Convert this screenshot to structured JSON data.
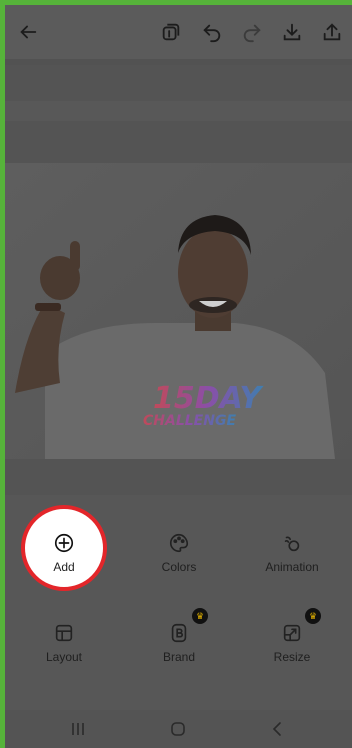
{
  "toolbar": {
    "back_icon": "arrow-left-icon",
    "pages_icon": "pages-icon",
    "undo_icon": "undo-icon",
    "redo_icon": "redo-icon",
    "download_icon": "download-icon",
    "share_icon": "share-icon"
  },
  "canvas": {
    "image": "photo-man-thumbs-up",
    "shirt_text_line1": "15DAY",
    "shirt_text_line2": "CHALLENGE"
  },
  "tools": [
    {
      "label": "Add",
      "icon": "plus-circle-icon",
      "premium": false
    },
    {
      "label": "Colors",
      "icon": "palette-icon",
      "premium": false
    },
    {
      "label": "Animation",
      "icon": "animation-icon",
      "premium": false
    },
    {
      "label": "Layout",
      "icon": "layout-icon",
      "premium": false
    },
    {
      "label": "Brand",
      "icon": "brand-icon",
      "premium": true
    },
    {
      "label": "Resize",
      "icon": "resize-icon",
      "premium": true
    }
  ],
  "premium_badge_icon": "crown-icon",
  "navbar": {
    "recents_icon": "recents-icon",
    "home_icon": "home-icon",
    "back_icon": "nav-back-icon"
  },
  "colors": {
    "highlight_ring": "#e3262a",
    "frame_green": "#56b33a",
    "premium_badge": "#e0b000"
  }
}
